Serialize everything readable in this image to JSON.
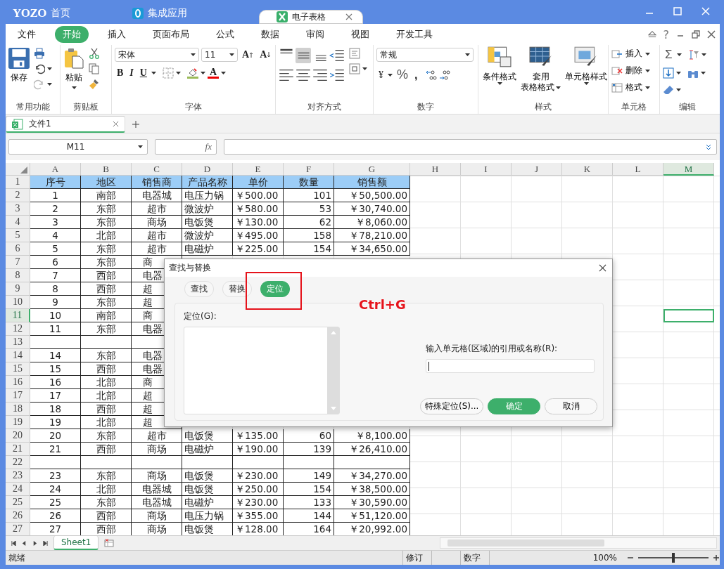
{
  "title_bar": {
    "logo": "YOZO",
    "tabs": [
      {
        "label": "首页",
        "kind": "home",
        "selected": false
      },
      {
        "label": "集成应用",
        "kind": "apps",
        "selected": false
      },
      {
        "label": "电子表格",
        "kind": "sheet",
        "selected": true
      }
    ]
  },
  "menu": {
    "items": [
      {
        "label": "文件",
        "selected": false
      },
      {
        "label": "开始",
        "selected": true
      },
      {
        "label": "插入",
        "selected": false
      },
      {
        "label": "页面布局",
        "selected": false
      },
      {
        "label": "公式",
        "selected": false
      },
      {
        "label": "数据",
        "selected": false
      },
      {
        "label": "审阅",
        "selected": false
      },
      {
        "label": "视图",
        "selected": false
      },
      {
        "label": "开发工具",
        "selected": false
      }
    ],
    "help": "?"
  },
  "ribbon": {
    "common": {
      "title": "常用功能",
      "save": "保存"
    },
    "clipboard": {
      "title": "剪贴板",
      "paste": "粘贴"
    },
    "font": {
      "title": "字体",
      "family": "宋体",
      "size": "11",
      "grow": "A",
      "shrink": "A",
      "bold": "B",
      "italic": "I",
      "underline": "U",
      "font_color_letter": "A"
    },
    "align": {
      "title": "对齐方式",
      "buttons": [
        {
          "kind": "top",
          "selected": false
        },
        {
          "kind": "middle",
          "selected": true
        },
        {
          "kind": "bottom",
          "selected": false
        },
        {
          "kind": "outdent",
          "selected": false
        },
        {
          "kind": "left",
          "selected": false
        },
        {
          "kind": "center",
          "selected": false
        },
        {
          "kind": "right",
          "selected": false
        },
        {
          "kind": "indent",
          "selected": false
        }
      ]
    },
    "number": {
      "title": "数字",
      "format": "常规",
      "currency": "¥",
      "percent": "%",
      "comma": ","
    },
    "styles": {
      "title": "样式",
      "buttons": [
        {
          "kind": "conditional",
          "lines": [
            "条件格式"
          ]
        },
        {
          "kind": "table",
          "lines": [
            "套用",
            "表格格式"
          ]
        },
        {
          "kind": "cell",
          "lines": [
            "单元格样式"
          ]
        }
      ]
    },
    "cells": {
      "title": "单元格",
      "buttons": [
        {
          "kind": "insert",
          "label": "插入"
        },
        {
          "kind": "delete",
          "label": "删除"
        },
        {
          "kind": "format",
          "label": "格式"
        }
      ]
    },
    "editing": {
      "title": "编辑",
      "sum": "Σ"
    }
  },
  "documents": {
    "tabs": [
      {
        "label": "文件1",
        "selected": true
      }
    ]
  },
  "formula_bar": {
    "name_box": "M11",
    "fx": "fx"
  },
  "sheet": {
    "columns": [
      {
        "label": "A",
        "selected": false
      },
      {
        "label": "B",
        "selected": false
      },
      {
        "label": "C",
        "selected": false
      },
      {
        "label": "D",
        "selected": false
      },
      {
        "label": "E",
        "selected": false
      },
      {
        "label": "F",
        "selected": false
      },
      {
        "label": "G",
        "selected": false
      },
      {
        "label": "H",
        "selected": false
      },
      {
        "label": "I",
        "selected": false
      },
      {
        "label": "J",
        "selected": false
      },
      {
        "label": "K",
        "selected": false
      },
      {
        "label": "L",
        "selected": false
      },
      {
        "label": "M",
        "selected": true
      }
    ],
    "rows": [
      {
        "number": "1",
        "kind": "header",
        "selected": false,
        "cells": [
          "序号",
          "地区",
          "销售商",
          "产品名称",
          "单价",
          "数量",
          "销售额"
        ]
      },
      {
        "number": "2",
        "kind": "data",
        "selected": false,
        "cells": [
          "1",
          "南部",
          "电器城",
          "电压力锅",
          "￥500.00",
          "101",
          "￥50,500.00"
        ]
      },
      {
        "number": "3",
        "kind": "data",
        "selected": false,
        "cells": [
          "2",
          "东部",
          "超市",
          "微波炉",
          "￥580.00",
          "53",
          "￥30,740.00"
        ]
      },
      {
        "number": "4",
        "kind": "data",
        "selected": false,
        "cells": [
          "3",
          "东部",
          "商场",
          "电饭煲",
          "￥130.00",
          "62",
          "￥8,060.00"
        ]
      },
      {
        "number": "5",
        "kind": "data",
        "selected": false,
        "cells": [
          "4",
          "北部",
          "超市",
          "微波炉",
          "￥495.00",
          "158",
          "￥78,210.00"
        ]
      },
      {
        "number": "6",
        "kind": "data",
        "selected": false,
        "cells": [
          "5",
          "东部",
          "超市",
          "电磁炉",
          "￥225.00",
          "154",
          "￥34,650.00"
        ]
      },
      {
        "number": "7",
        "kind": "data",
        "selected": false,
        "cells": [
          "6",
          "东部",
          "商"
        ]
      },
      {
        "number": "8",
        "kind": "data",
        "selected": false,
        "cells": [
          "7",
          "西部",
          "电器"
        ]
      },
      {
        "number": "9",
        "kind": "data",
        "selected": false,
        "cells": [
          "8",
          "西部",
          "超"
        ]
      },
      {
        "number": "10",
        "kind": "data",
        "selected": false,
        "cells": [
          "9",
          "东部",
          "超"
        ]
      },
      {
        "number": "11",
        "kind": "data",
        "selected": true,
        "cells": [
          "10",
          "南部",
          "商"
        ]
      },
      {
        "number": "12",
        "kind": "data",
        "selected": false,
        "cells": [
          "11",
          "东部",
          "电器"
        ]
      },
      {
        "number": "13",
        "kind": "data",
        "selected": false,
        "cells": []
      },
      {
        "number": "14",
        "kind": "data",
        "selected": false,
        "cells": [
          "14",
          "东部",
          "电器"
        ]
      },
      {
        "number": "15",
        "kind": "data",
        "selected": false,
        "cells": [
          "15",
          "西部",
          "电器"
        ]
      },
      {
        "number": "16",
        "kind": "data",
        "selected": false,
        "cells": [
          "16",
          "北部",
          "商"
        ]
      },
      {
        "number": "17",
        "kind": "data",
        "selected": false,
        "cells": [
          "17",
          "北部",
          "超"
        ]
      },
      {
        "number": "18",
        "kind": "data",
        "selected": false,
        "cells": [
          "18",
          "西部",
          "超"
        ]
      },
      {
        "number": "19",
        "kind": "data",
        "selected": false,
        "cells": [
          "19",
          "北部",
          "超"
        ]
      },
      {
        "number": "20",
        "kind": "data",
        "selected": false,
        "cells": [
          "20",
          "东部",
          "超市",
          "电饭煲",
          "￥135.00",
          "60",
          "￥8,100.00"
        ]
      },
      {
        "number": "21",
        "kind": "data",
        "selected": false,
        "cells": [
          "21",
          "西部",
          "商场",
          "电磁炉",
          "￥190.00",
          "139",
          "￥26,410.00"
        ]
      },
      {
        "number": "22",
        "kind": "data",
        "selected": false,
        "cells": []
      },
      {
        "number": "23",
        "kind": "data",
        "selected": false,
        "cells": [
          "23",
          "东部",
          "商场",
          "电饭煲",
          "￥230.00",
          "149",
          "￥34,270.00"
        ]
      },
      {
        "number": "24",
        "kind": "data",
        "selected": false,
        "cells": [
          "24",
          "北部",
          "电器城",
          "电饭煲",
          "￥250.00",
          "154",
          "￥38,500.00"
        ]
      },
      {
        "number": "25",
        "kind": "data",
        "selected": false,
        "cells": [
          "25",
          "东部",
          "电器城",
          "电磁炉",
          "￥230.00",
          "133",
          "￥30,590.00"
        ]
      },
      {
        "number": "26",
        "kind": "data",
        "selected": false,
        "cells": [
          "26",
          "西部",
          "商场",
          "电压力锅",
          "￥355.00",
          "144",
          "￥51,120.00"
        ]
      },
      {
        "number": "27",
        "kind": "data",
        "selected": false,
        "cells": [
          "27",
          "西部",
          "商场",
          "电饭煲",
          "￥128.00",
          "164",
          "￥20,992.00"
        ]
      }
    ]
  },
  "dialog": {
    "title": "查找与替换",
    "tabs": [
      {
        "label": "查找",
        "selected": false
      },
      {
        "label": "替换",
        "selected": false
      },
      {
        "label": "定位",
        "selected": true
      }
    ],
    "list_label": "定位(G):",
    "reference_label": "输入单元格(区域)的引用或名称(R):",
    "buttons": [
      {
        "label": "特殊定位(S)...",
        "kind": "secondary"
      },
      {
        "label": "确定",
        "kind": "primary"
      },
      {
        "label": "取消",
        "kind": "secondary"
      }
    ],
    "annotation": "Ctrl+G"
  },
  "sheet_tabs": [
    {
      "label": "Sheet1",
      "selected": true
    }
  ],
  "status_bar": {
    "status": "就绪",
    "cells": [
      "修订",
      "数字"
    ],
    "zoom": "100%",
    "level": 0.5
  }
}
